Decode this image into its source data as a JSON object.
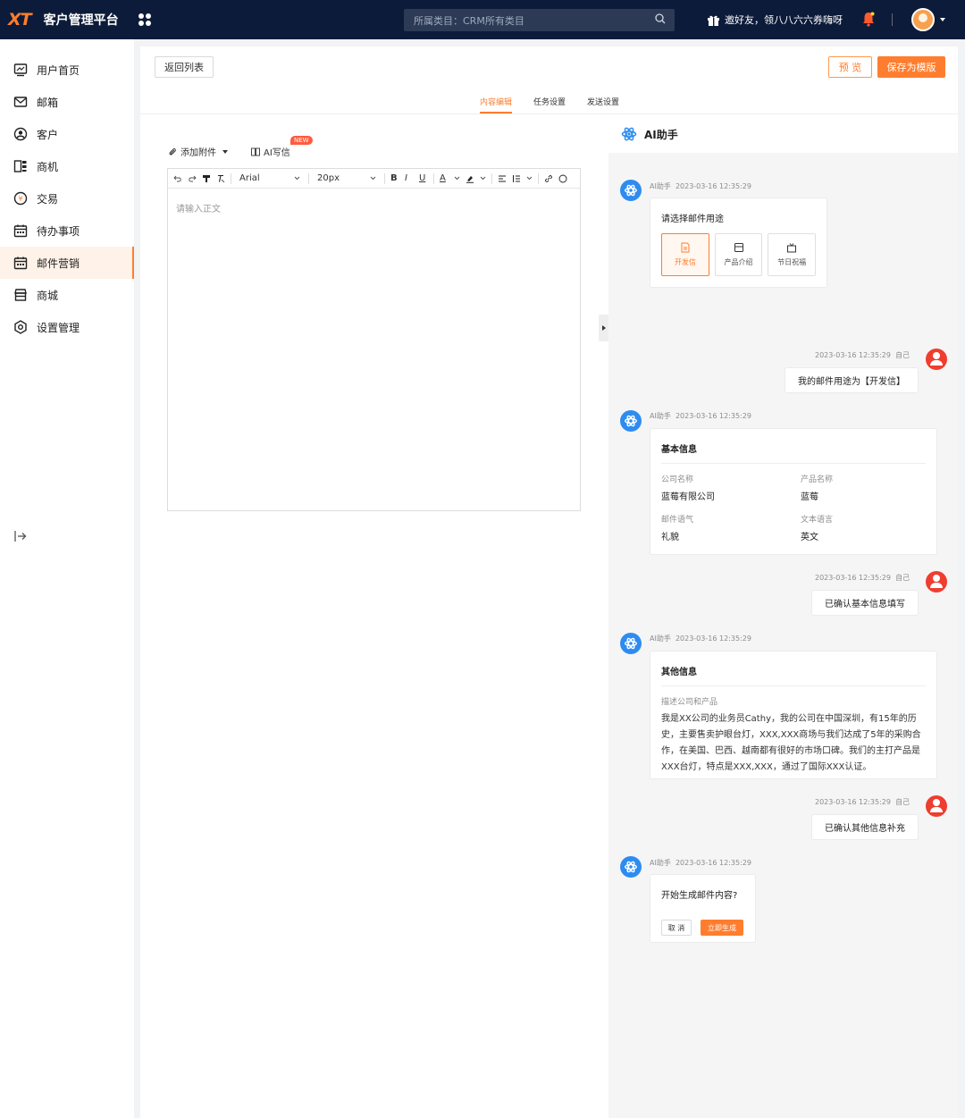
{
  "topbar": {
    "logo": "XT",
    "app_title": "客户管理平台",
    "search_placeholder": "所属类目：CRM所有类目",
    "invite_text": "邀好友，领八八六六券嗨呀"
  },
  "sidebar": {
    "items": [
      {
        "label": "用户首页",
        "icon": "monitor-icon"
      },
      {
        "label": "邮箱",
        "icon": "mail-icon"
      },
      {
        "label": "客户",
        "icon": "customer-icon"
      },
      {
        "label": "商机",
        "icon": "opportunity-icon"
      },
      {
        "label": "交易",
        "icon": "transaction-icon"
      },
      {
        "label": "待办事项",
        "icon": "calendar-icon"
      },
      {
        "label": "邮件营销",
        "icon": "calendar-icon",
        "active": true
      },
      {
        "label": "商城",
        "icon": "store-icon"
      },
      {
        "label": "设置管理",
        "icon": "settings-icon"
      }
    ]
  },
  "main": {
    "back_label": "返回列表",
    "preview_label": "预 览",
    "save_template_label": "保存为模版",
    "tabs": [
      "内容编辑",
      "任务设置",
      "发送设置"
    ],
    "active_tab": "内容编辑"
  },
  "editor": {
    "attach_label": "添加附件",
    "ai_write_label": "AI写信",
    "new_badge": "NEW",
    "font_family": "Arial",
    "font_size": "20px",
    "placeholder": "请输入正文"
  },
  "ai_panel": {
    "title": "AI助手",
    "bot_name": "AI助手",
    "self_name": "自己",
    "timestamp": "2023-03-16 12:35:29",
    "msg1": {
      "prompt": "请选择邮件用途",
      "options": [
        "开发信",
        "产品介绍",
        "节日祝福"
      ],
      "selected": "开发信"
    },
    "reply1": "我的邮件用途为【开发信】",
    "msg2": {
      "title": "基本信息",
      "fields": [
        {
          "label": "公司名称",
          "value": "蓝莓有限公司"
        },
        {
          "label": "产品名称",
          "value": "蓝莓"
        },
        {
          "label": "邮件语气",
          "value": "礼貌"
        },
        {
          "label": "文本语言",
          "value": "英文"
        }
      ]
    },
    "reply2": "已确认基本信息填写",
    "msg3": {
      "title": "其他信息",
      "desc_label": "描述公司和产品",
      "desc_text": "我是XX公司的业务员Cathy，我的公司在中国深圳，有15年的历史，主要售卖护眼台灯，XXX,XXX商场与我们达成了5年的采购合作，在美国、巴西、越南都有很好的市场口碑。我们的主打产品是XXX台灯，特点是XXX,XXX，通过了国际XXX认证。"
    },
    "reply3": "已确认其他信息补充",
    "msg4": {
      "prompt": "开始生成邮件内容?",
      "cancel_label": "取 消",
      "generate_label": "立即生成"
    }
  },
  "colors": {
    "accent": "#ff7d2e",
    "topbar_bg": "#0d1b3a",
    "bot_avatar": "#2e8cf0",
    "user_avatar": "#ef3d2f"
  }
}
